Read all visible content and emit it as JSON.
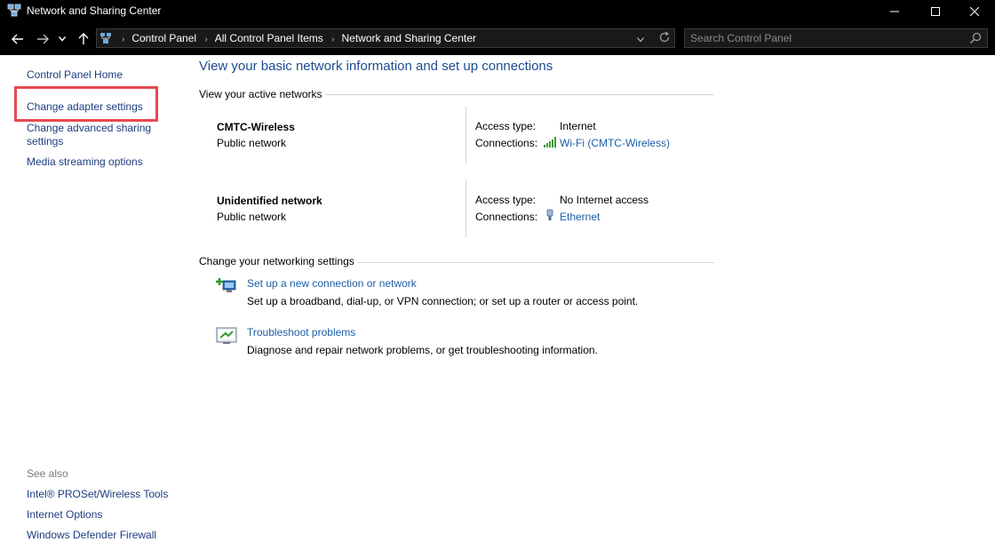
{
  "window": {
    "title": "Network and Sharing Center",
    "controls": {
      "minimize": "minimize",
      "maximize": "maximize",
      "close": "close"
    }
  },
  "address": {
    "breadcrumbs": [
      "Control Panel",
      "All Control Panel Items",
      "Network and Sharing Center"
    ],
    "search_placeholder": "Search Control Panel"
  },
  "sidebar": {
    "home": "Control Panel Home",
    "links": [
      "Change adapter settings",
      "Change advanced sharing",
      "settings",
      "Media streaming options"
    ],
    "see_also_label": "See also",
    "see_also": [
      "Intel® PROSet/Wireless Tools",
      "Internet Options",
      "Windows Defender Firewall"
    ],
    "highlight_color": "#e8474d"
  },
  "main": {
    "title": "View your basic network information and set up connections",
    "active_label": "View your active networks",
    "networks": [
      {
        "name": "CMTC-Wireless",
        "type": "Public network",
        "access_label": "Access type:",
        "access_value": "Internet",
        "conn_label": "Connections:",
        "conn_value": "Wi-Fi (CMTC-Wireless)",
        "conn_icon": "wifi-signal-icon"
      },
      {
        "name": "Unidentified network",
        "type": "Public network",
        "access_label": "Access type:",
        "access_value": "No Internet access",
        "conn_label": "Connections:",
        "conn_value": "Ethernet",
        "conn_icon": "ethernet-icon"
      }
    ],
    "change_label": "Change your networking settings",
    "tasks": [
      {
        "link": "Set up a new connection or network",
        "desc": "Set up a broadband, dial-up, or VPN connection; or set up a router or access point.",
        "icon": "new-connection-icon"
      },
      {
        "link": "Troubleshoot problems",
        "desc": "Diagnose and repair network problems, or get troubleshooting information.",
        "icon": "troubleshoot-icon"
      }
    ]
  }
}
